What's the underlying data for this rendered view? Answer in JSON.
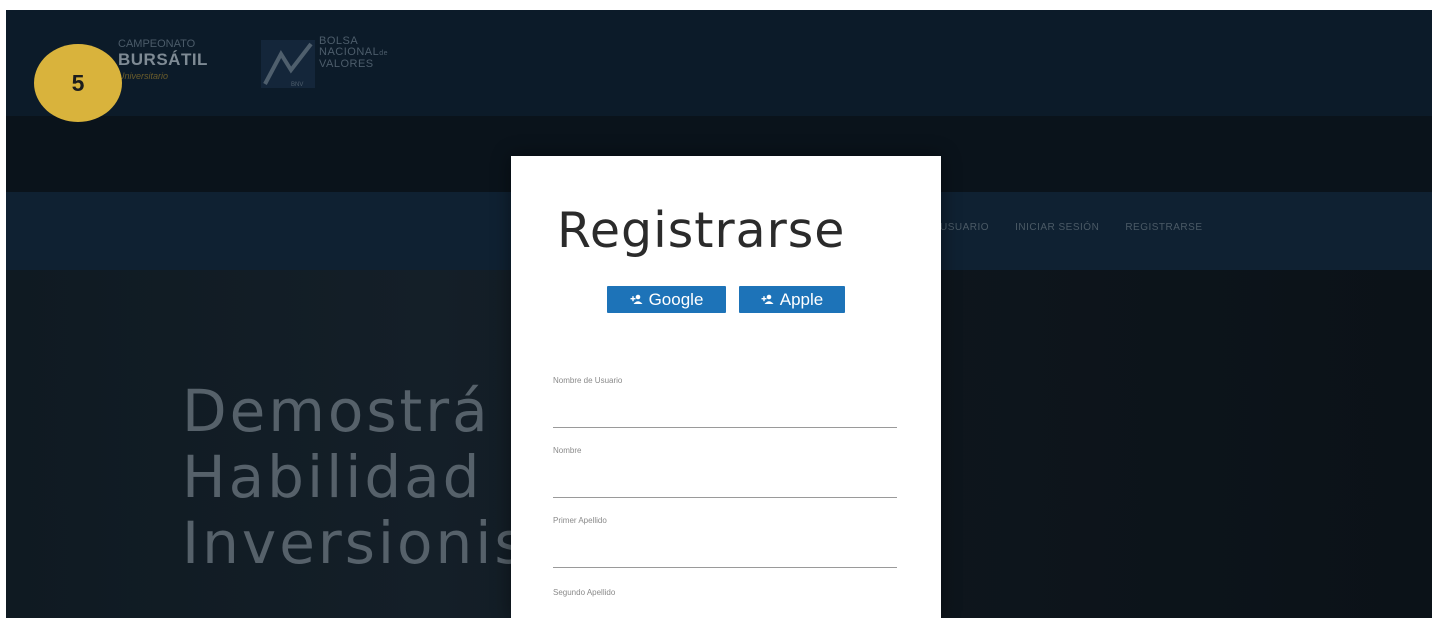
{
  "step_badge": "5",
  "header": {
    "logo_left": {
      "line1": "CAMPEONATO",
      "line2": "BURSÁTIL",
      "line3": "Universitario"
    },
    "logo_right": {
      "line1": "BOLSA",
      "line2": "NACIONAL",
      "line2_suffix": "de",
      "line3": "VALORES",
      "mark": "BNV"
    }
  },
  "nav": {
    "items": [
      {
        "label": "USUARIO"
      },
      {
        "label": "INICIAR SESIÓN"
      },
      {
        "label": "REGISTRARSE"
      }
    ]
  },
  "hero": {
    "lines": [
      "Demostrá",
      "Habilidad",
      "Inversionis"
    ]
  },
  "modal": {
    "title": "Registrarse",
    "google_label": "Google",
    "apple_label": "Apple",
    "fields": [
      {
        "label": "Nombre de Usuario",
        "value": ""
      },
      {
        "label": "Nombre",
        "value": ""
      },
      {
        "label": "Primer Apellido",
        "value": ""
      },
      {
        "label": "Segundo Apellido",
        "value": ""
      }
    ]
  },
  "colors": {
    "accent": "#1d73b8",
    "badge": "#d9b33c",
    "background": "#0b1620"
  }
}
